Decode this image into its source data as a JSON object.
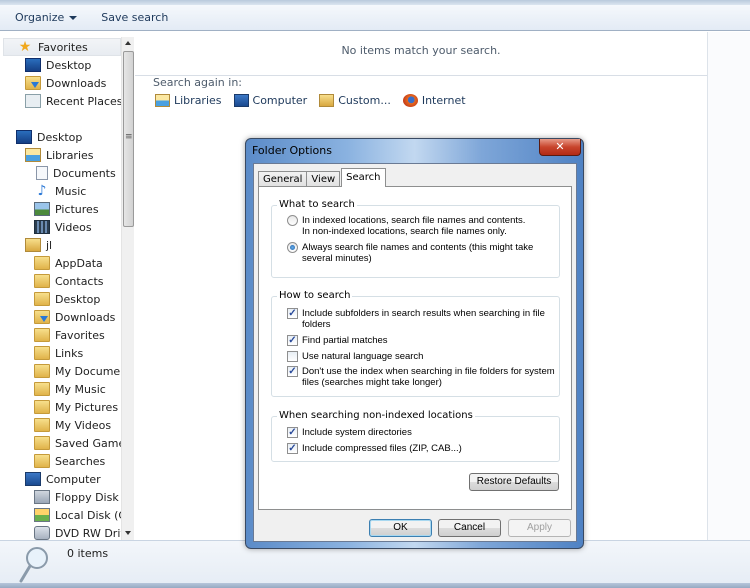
{
  "toolbar": {
    "organize_label": "Organize",
    "save_search_label": "Save search"
  },
  "nav": {
    "items": [
      {
        "label": "Favorites",
        "icon": "star-icon"
      },
      {
        "label": "Desktop",
        "icon": "desktop-icon"
      },
      {
        "label": "Downloads",
        "icon": "downloads-folder-icon"
      },
      {
        "label": "Recent Places",
        "icon": "recent-places-icon"
      },
      {
        "label": "Desktop",
        "icon": "desktop-icon"
      },
      {
        "label": "Libraries",
        "icon": "libraries-icon"
      },
      {
        "label": "Documents",
        "icon": "documents-icon"
      },
      {
        "label": "Music",
        "icon": "music-icon"
      },
      {
        "label": "Pictures",
        "icon": "pictures-icon"
      },
      {
        "label": "Videos",
        "icon": "videos-icon"
      },
      {
        "label": "jl",
        "icon": "user-folder-icon"
      },
      {
        "label": "AppData",
        "icon": "folder-icon"
      },
      {
        "label": "Contacts",
        "icon": "contacts-folder-icon"
      },
      {
        "label": "Desktop",
        "icon": "desktop-folder-icon"
      },
      {
        "label": "Downloads",
        "icon": "downloads-folder-icon"
      },
      {
        "label": "Favorites",
        "icon": "favorites-folder-icon"
      },
      {
        "label": "Links",
        "icon": "links-folder-icon"
      },
      {
        "label": "My Documents",
        "icon": "documents-folder-icon"
      },
      {
        "label": "My Music",
        "icon": "music-folder-icon"
      },
      {
        "label": "My Pictures",
        "icon": "pictures-folder-icon"
      },
      {
        "label": "My Videos",
        "icon": "videos-folder-icon"
      },
      {
        "label": "Saved Games",
        "icon": "saved-games-folder-icon"
      },
      {
        "label": "Searches",
        "icon": "searches-folder-icon"
      },
      {
        "label": "Computer",
        "icon": "computer-icon"
      },
      {
        "label": "Floppy Disk Drive",
        "icon": "floppy-drive-icon"
      },
      {
        "label": "Local Disk (C:)",
        "icon": "local-disk-icon"
      },
      {
        "label": "DVD RW Drive (",
        "icon": "dvd-drive-icon"
      }
    ]
  },
  "content": {
    "no_items_text": "No items match your search.",
    "search_again_label": "Search again in:",
    "locations": [
      {
        "label": "Libraries",
        "icon": "libraries-icon"
      },
      {
        "label": "Computer",
        "icon": "computer-icon"
      },
      {
        "label": "Custom...",
        "icon": "custom-folder-icon"
      },
      {
        "label": "Internet",
        "icon": "firefox-icon"
      }
    ]
  },
  "status": {
    "item_count": "0 items"
  },
  "dialog": {
    "title": "Folder Options",
    "close_glyph": "✕",
    "tabs": [
      "General",
      "View",
      "Search"
    ],
    "active_tab": "Search",
    "what_to_search": {
      "label": "What to search",
      "options": [
        {
          "text": "In indexed locations, search file names and contents. In non-indexed locations, search file names only.",
          "line1": "In indexed locations, search file names and contents.",
          "line2": "In non-indexed locations, search file names only.",
          "selected": false
        },
        {
          "text": "Always search file names and contents (this might take several minutes)",
          "line1": "Always search file names and contents (this might take",
          "line2": "several minutes)",
          "selected": true
        }
      ]
    },
    "how_to_search": {
      "label": "How to search",
      "options": [
        {
          "line1": "Include subfolders in search results when searching in file",
          "line2": "folders",
          "checked": true
        },
        {
          "line1": "Find partial matches",
          "line2": "",
          "checked": true
        },
        {
          "line1": "Use natural language search",
          "line2": "",
          "checked": false
        },
        {
          "line1": "Don't use the index when searching in file folders for system",
          "line2": "files (searches might take longer)",
          "checked": true
        }
      ]
    },
    "non_indexed": {
      "label": "When searching non-indexed locations",
      "options": [
        {
          "line1": "Include system directories",
          "checked": true
        },
        {
          "line1": "Include compressed files (ZIP, CAB...)",
          "checked": true
        }
      ]
    },
    "restore_defaults_label": "Restore Defaults",
    "ok_label": "OK",
    "cancel_label": "Cancel",
    "apply_label": "Apply",
    "check_glyph": "✓"
  }
}
